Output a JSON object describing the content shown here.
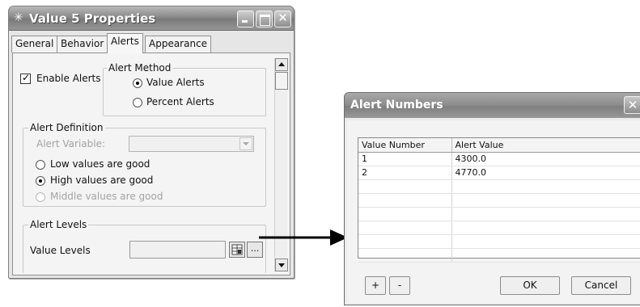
{
  "properties_window": {
    "title": "Value 5 Properties",
    "tabs": [
      {
        "label": "General"
      },
      {
        "label": "Behavior"
      },
      {
        "label": "Alerts"
      },
      {
        "label": "Appearance"
      }
    ],
    "active_tab": "Alerts",
    "enable_alerts": {
      "label": "Enable Alerts",
      "checked": true
    },
    "alert_method": {
      "legend": "Alert Method",
      "options": [
        {
          "label": "Value Alerts",
          "selected": true
        },
        {
          "label": "Percent Alerts",
          "selected": false
        }
      ]
    },
    "alert_definition": {
      "legend": "Alert Definition",
      "variable_label": "Alert Variable:",
      "variable_value": "",
      "options": [
        {
          "label": "Low values are good",
          "selected": false,
          "enabled": true
        },
        {
          "label": "High values are good",
          "selected": true,
          "enabled": true
        },
        {
          "label": "Middle values are good",
          "selected": false,
          "enabled": false
        }
      ]
    },
    "alert_levels": {
      "legend": "Alert Levels",
      "value_levels_label": "Value Levels",
      "value_levels_value": "",
      "browse_label": "..."
    }
  },
  "alert_dialog": {
    "title": "Alert Numbers",
    "close_glyph": "✕",
    "columns": [
      "Value Number",
      "Alert Value"
    ],
    "rows": [
      {
        "number": "1",
        "value": "4300.0"
      },
      {
        "number": "2",
        "value": "4770.0"
      }
    ],
    "add_label": "+",
    "remove_label": "-",
    "ok_label": "OK",
    "cancel_label": "Cancel"
  }
}
